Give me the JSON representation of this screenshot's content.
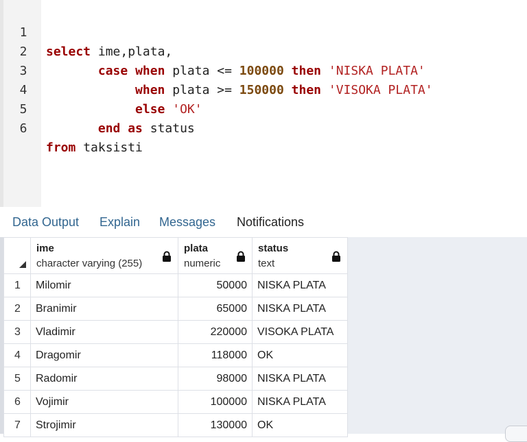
{
  "editor": {
    "line_numbers": [
      "1",
      "2",
      "3",
      "4",
      "5",
      "6"
    ],
    "lines": {
      "l1": {
        "kw1": "select",
        "t1": " ime,plata,"
      },
      "l2": {
        "kw1": "case",
        "kw2": "when",
        "t1": " plata <= ",
        "num": "100000",
        "kw3": "then",
        "str": "'NISKA PLATA'"
      },
      "l3": {
        "kw1": "when",
        "t1": " plata >= ",
        "num": "150000",
        "kw2": "then",
        "str": "'VISOKA PLATA'"
      },
      "l4": {
        "kw1": "else",
        "str": "'OK'"
      },
      "l5": {
        "kw1": "end",
        "kw2": "as",
        "t1": " status"
      },
      "l6": {
        "kw1": "from",
        "t1": " taksisti"
      }
    }
  },
  "tabs": [
    {
      "label": "Data Output"
    },
    {
      "label": "Explain"
    },
    {
      "label": "Messages"
    },
    {
      "label": "Notifications"
    }
  ],
  "grid": {
    "columns": [
      {
        "name": "ime",
        "type": "character varying (255)",
        "icon": "lock-icon"
      },
      {
        "name": "plata",
        "type": "numeric",
        "icon": "lock-icon"
      },
      {
        "name": "status",
        "type": "text",
        "icon": "lock-icon"
      }
    ],
    "rows": [
      {
        "n": "1",
        "ime": "Milomir",
        "plata": "50000",
        "status": "NISKA PLATA"
      },
      {
        "n": "2",
        "ime": "Branimir",
        "plata": "65000",
        "status": "NISKA PLATA"
      },
      {
        "n": "3",
        "ime": "Vladimir",
        "plata": "220000",
        "status": "VISOKA PLATA"
      },
      {
        "n": "4",
        "ime": "Dragomir",
        "plata": "118000",
        "status": "OK"
      },
      {
        "n": "5",
        "ime": "Radomir",
        "plata": "98000",
        "status": "NISKA PLATA"
      },
      {
        "n": "6",
        "ime": "Vojimir",
        "plata": "100000",
        "status": "NISKA PLATA"
      },
      {
        "n": "7",
        "ime": "Strojimir",
        "plata": "130000",
        "status": "OK"
      }
    ]
  },
  "colors": {
    "keyword": "#990000",
    "number": "#7c4a10",
    "string": "#b22222",
    "tab_link": "#326690"
  }
}
